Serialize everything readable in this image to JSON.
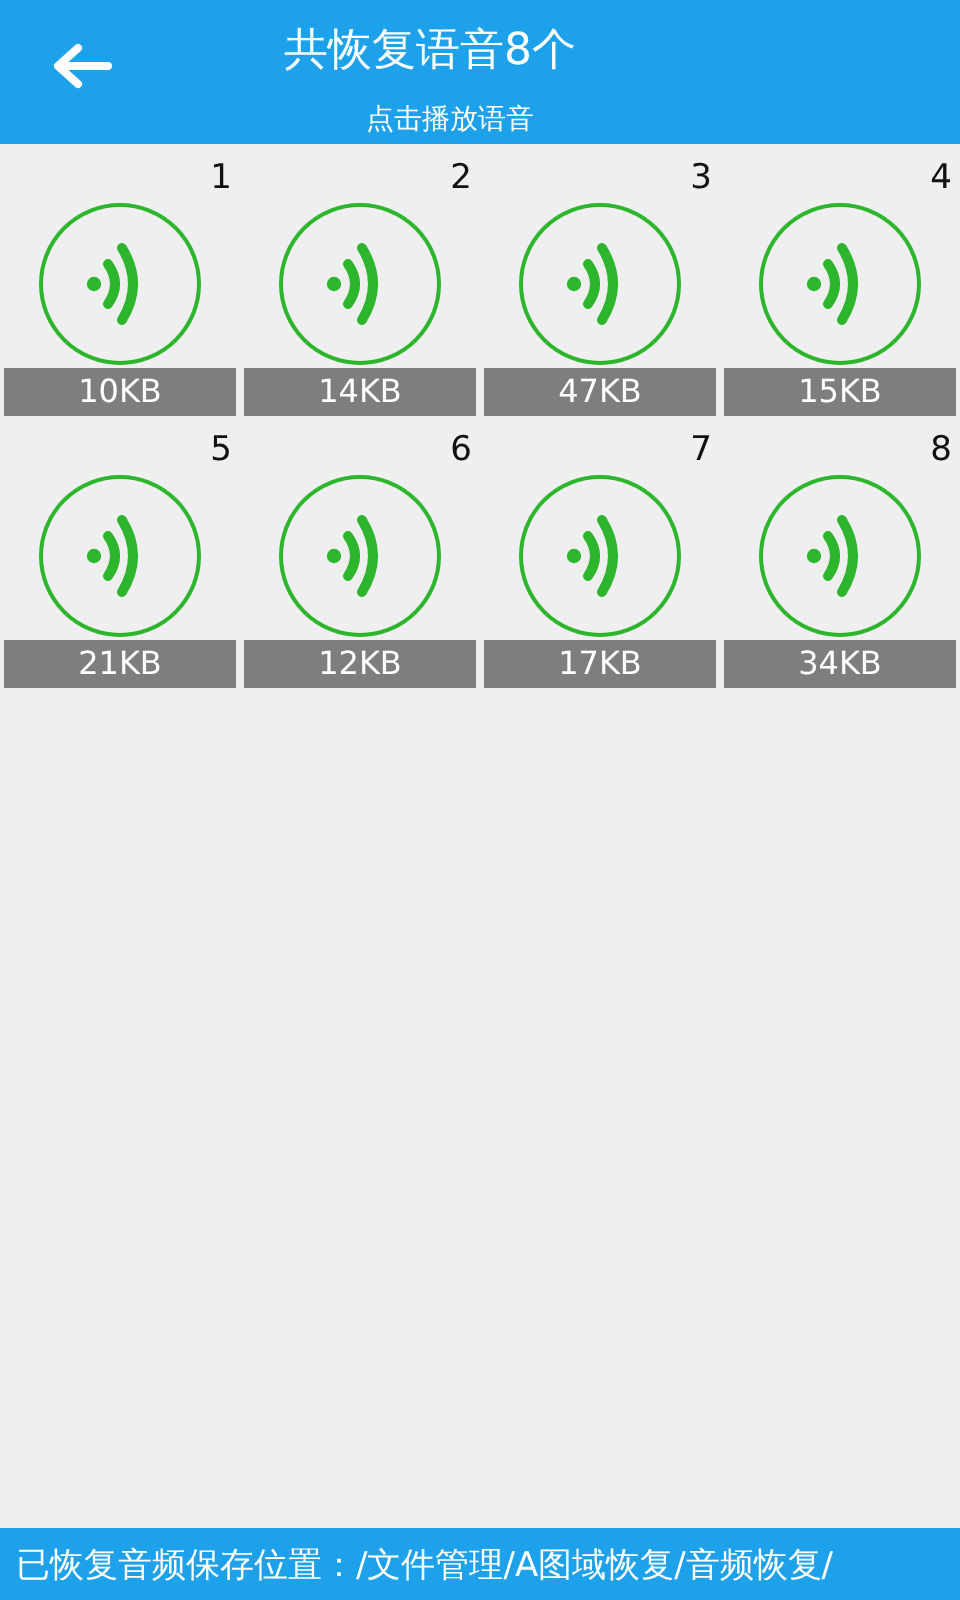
{
  "header": {
    "title": "共恢复语音8个",
    "subtitle": "点击播放语音"
  },
  "recordings": [
    {
      "number": "1",
      "size": "10KB"
    },
    {
      "number": "2",
      "size": "14KB"
    },
    {
      "number": "3",
      "size": "47KB"
    },
    {
      "number": "4",
      "size": "15KB"
    },
    {
      "number": "5",
      "size": "21KB"
    },
    {
      "number": "6",
      "size": "12KB"
    },
    {
      "number": "7",
      "size": "17KB"
    },
    {
      "number": "8",
      "size": "34KB"
    }
  ],
  "footer": {
    "text": "已恢复音频保存位置：/文件管理/A图域恢复/音频恢复/"
  }
}
